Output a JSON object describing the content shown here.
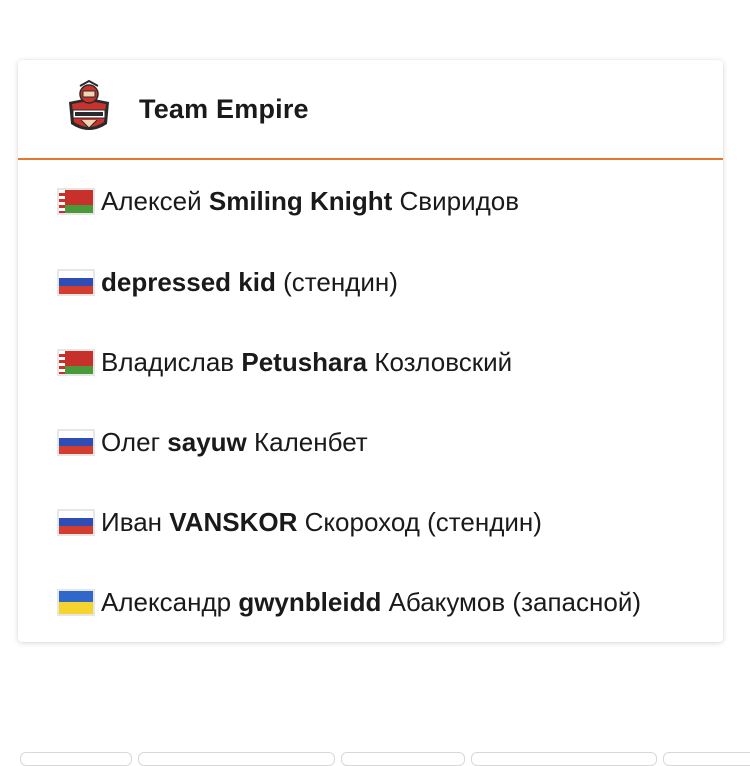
{
  "team": {
    "name": "Team Empire",
    "logo_icon": "team-empire-logo-icon",
    "accent_color": "#e8772e"
  },
  "players": [
    {
      "flag": "belarus",
      "first": "Алексей",
      "nick": "Smiling Knight",
      "last": "Свиридов",
      "note": ""
    },
    {
      "flag": "russia",
      "first": "",
      "nick": "depressed kid",
      "last": "",
      "note": "(стендин)"
    },
    {
      "flag": "belarus",
      "first": "Владислав",
      "nick": "Petushara",
      "last": "Козловский",
      "note": ""
    },
    {
      "flag": "russia",
      "first": "Олег",
      "nick": "sayuw",
      "last": "Каленбет",
      "note": ""
    },
    {
      "flag": "russia",
      "first": "Иван",
      "nick": "VANSKOR",
      "last": "Скороход",
      "note": "(стендин)"
    },
    {
      "flag": "ukraine",
      "first": "Александр",
      "nick": "gwynbleidd",
      "last": "Абакумов",
      "note": "(запасной)"
    }
  ]
}
